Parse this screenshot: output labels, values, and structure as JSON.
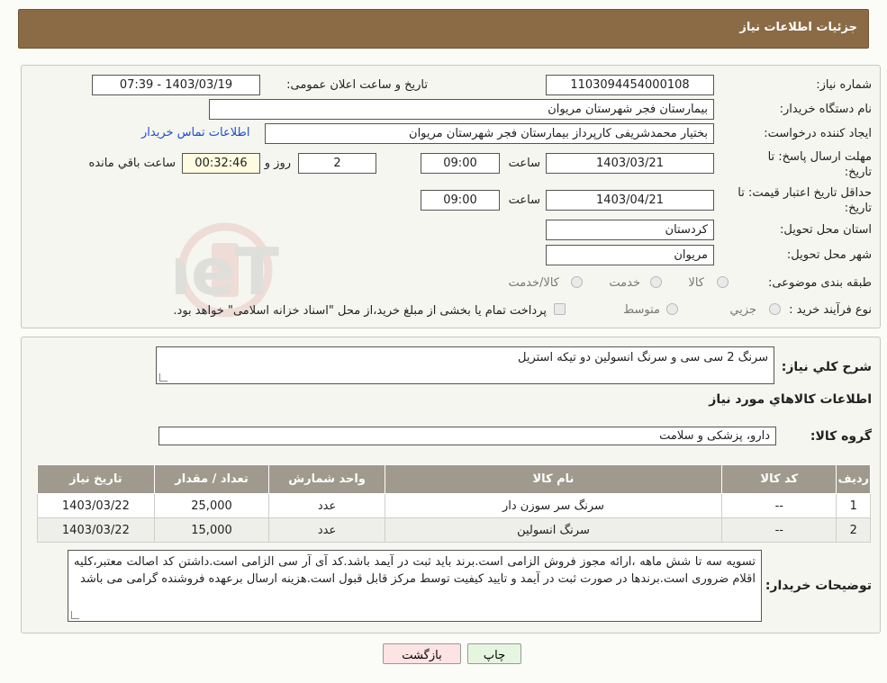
{
  "header": {
    "title": "جزئیات اطلاعات نیاز"
  },
  "form": {
    "need_number_label": "شماره نیاز:",
    "need_number": "1103094454000108",
    "announce_label": "تاریخ و ساعت اعلان عمومی:",
    "announce_value": "1403/03/19 - 07:39",
    "buyer_org_label": "نام دستگاه خریدار:",
    "buyer_org": "بیمارستان فجر شهرستان مریوان",
    "requester_label": "ایجاد کننده درخواست:",
    "requester": "بختیار محمدشریفی کارپرداز بیمارستان فجر شهرستان مریوان",
    "contact_link": "اطلاعات تماس خریدار",
    "deadline_label": "مهلت ارسال پاسخ: تا تاریخ:",
    "deadline_date": "1403/03/21",
    "time_label": "ساعت",
    "deadline_time": "09:00",
    "days_value": "2",
    "days_label": "روز و",
    "remaining_time": "00:32:46",
    "remaining_label": "ساعت باقي مانده",
    "validity_label": "حداقل تاریخ اعتبار قیمت: تا تاریخ:",
    "validity_date": "1403/04/21",
    "validity_time": "09:00",
    "province_label": "استان محل تحویل:",
    "province": "کردستان",
    "city_label": "شهر محل تحویل:",
    "city": "مریوان",
    "category_label": "طبقه بندی موضوعی:",
    "category_options": [
      "کالا",
      "خدمت",
      "کالا/خدمت"
    ],
    "process_label": "نوع فرآیند خرید :",
    "process_options": [
      "جزیي",
      "متوسط"
    ],
    "process_note": "پرداخت تمام یا بخشی از مبلغ خرید،از محل \"اسناد خزانه اسلامی\" خواهد بود."
  },
  "description": {
    "label": "شرح کلي نیاز:",
    "value": "سرنگ 2 سی سی و سرنگ انسولین دو تیکه استریل"
  },
  "goods": {
    "section_title": "اطلاعات کالاهاي مورد نیاز",
    "group_label": "گروه کالا:",
    "group_value": "دارو، پزشکی و سلامت",
    "columns": [
      "ردیف",
      "کد کالا",
      "نام کالا",
      "واحد شمارش",
      "تعداد / مقدار",
      "تاریخ نیاز"
    ],
    "rows": [
      [
        "1",
        "--",
        "سرنگ سر سوزن دار",
        "عدد",
        "25,000",
        "1403/03/22"
      ],
      [
        "2",
        "--",
        "سرنگ انسولین",
        "عدد",
        "15,000",
        "1403/03/22"
      ]
    ]
  },
  "buyer_notes": {
    "label": "توضیحات خریدار:",
    "text": "تسویه سه تا شش ماهه ،ارائه مجوز فروش  الزامی است.برند باید ثبت در آیمد باشد.کد آی آر سی الزامی است.داشتن کد اصالت معتبر،کلیه اقلام ضروری است.برندها در صورت ثبت در آیمد و تایید کیفیت توسط مرکز قابل قبول است.هزینه ارسال برعهده فروشنده گرامی می باشد"
  },
  "buttons": {
    "print": "چاپ",
    "back": "بازگشت"
  },
  "watermark": {
    "text": "AriaTender.neT"
  },
  "colors": {
    "header": "#8b6b45",
    "table_header": "#a09a8e",
    "link": "#1a4fd0",
    "back_button": "#fde3e3",
    "print_button": "#e6f5e0"
  }
}
